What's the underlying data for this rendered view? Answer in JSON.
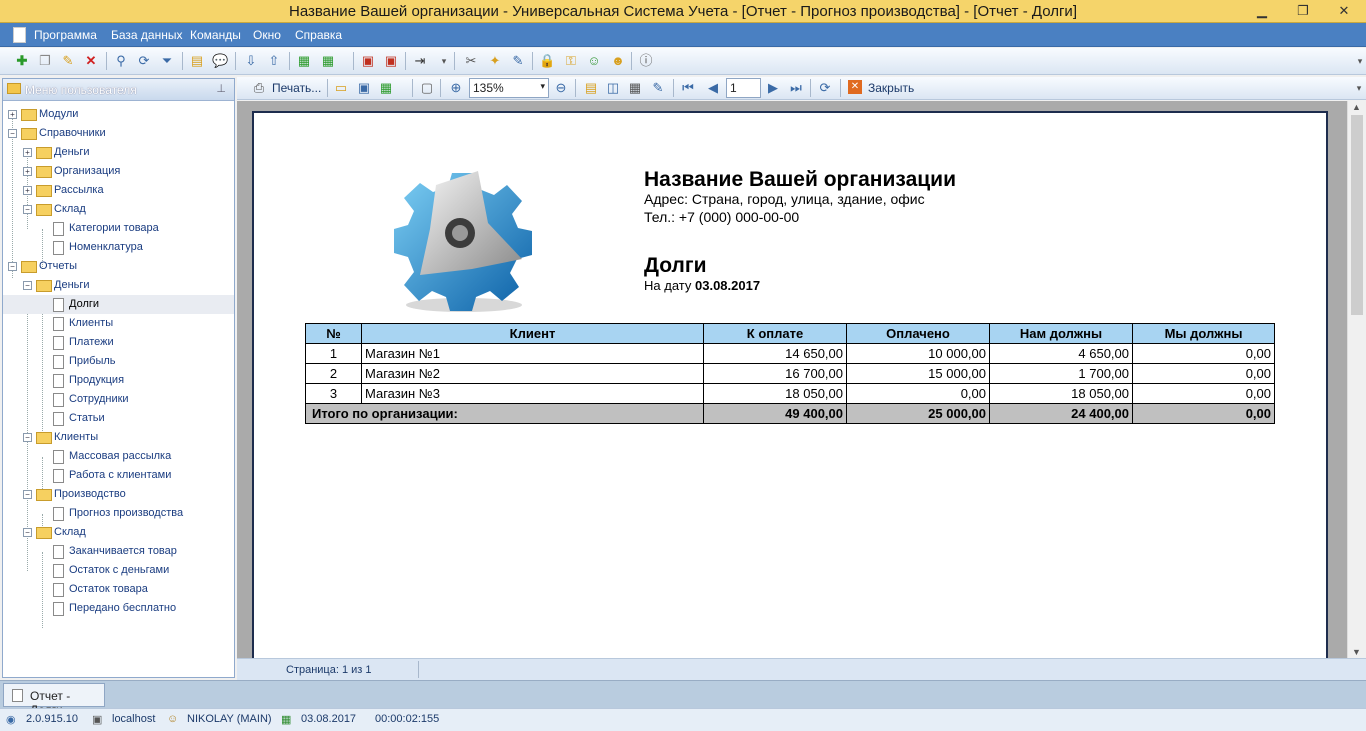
{
  "window": {
    "title": "Название Вашей организации - Универсальная Система Учета - [Отчет - Прогноз производства] - [Отчет - Долги]"
  },
  "menu": [
    "Программа",
    "База данных",
    "Команды",
    "Окно",
    "Справка"
  ],
  "sidebar": {
    "header": "Меню пользователя",
    "items": [
      {
        "label": "Модули"
      },
      {
        "label": "Справочники"
      },
      {
        "label": "Деньги"
      },
      {
        "label": "Организация"
      },
      {
        "label": "Рассылка"
      },
      {
        "label": "Склад"
      },
      {
        "label": "Категории товара"
      },
      {
        "label": "Номенклатура"
      },
      {
        "label": "Отчеты"
      },
      {
        "label": "Деньги"
      },
      {
        "label": "Долги"
      },
      {
        "label": "Клиенты"
      },
      {
        "label": "Платежи"
      },
      {
        "label": "Прибыль"
      },
      {
        "label": "Продукция"
      },
      {
        "label": "Сотрудники"
      },
      {
        "label": "Статьи"
      },
      {
        "label": "Клиенты"
      },
      {
        "label": "Массовая рассылка"
      },
      {
        "label": "Работа с клиентами"
      },
      {
        "label": "Производство"
      },
      {
        "label": "Прогноз производства"
      },
      {
        "label": "Склад"
      },
      {
        "label": "Заканчивается товар"
      },
      {
        "label": "Остаток с деньгами"
      },
      {
        "label": "Остаток товара"
      },
      {
        "label": "Передано бесплатно"
      }
    ]
  },
  "preview_toolbar": {
    "print": "Печать...",
    "zoom": "135%",
    "page": "1",
    "close": "Закрыть"
  },
  "report": {
    "org": "Название Вашей организации",
    "address": "Адрес: Страна, город, улица, здание, офис",
    "phone": "Тел.: +7 (000) 000-00-00",
    "title": "Долги",
    "date_label": "На дату",
    "date": "03.08.2017",
    "columns": [
      "№",
      "Клиент",
      "К оплате",
      "Оплачено",
      "Нам должны",
      "Мы должны"
    ],
    "rows": [
      [
        "1",
        "Магазин №1",
        "14 650,00",
        "10 000,00",
        "4 650,00",
        "0,00"
      ],
      [
        "2",
        "Магазин №2",
        "16 700,00",
        "15 000,00",
        "1 700,00",
        "0,00"
      ],
      [
        "3",
        "Магазин №3",
        "18 050,00",
        "0,00",
        "18 050,00",
        "0,00"
      ]
    ],
    "total": [
      "Итого по организации:",
      "49 400,00",
      "25 000,00",
      "24 400,00",
      "0,00"
    ]
  },
  "page_status": "Страница: 1 из 1",
  "task_tab": "Отчет - Долги",
  "status": {
    "version": "2.0.915.10",
    "server": "localhost",
    "user": "NIKOLAY (MAIN)",
    "date": "03.08.2017",
    "time": "00:00:02:155"
  }
}
